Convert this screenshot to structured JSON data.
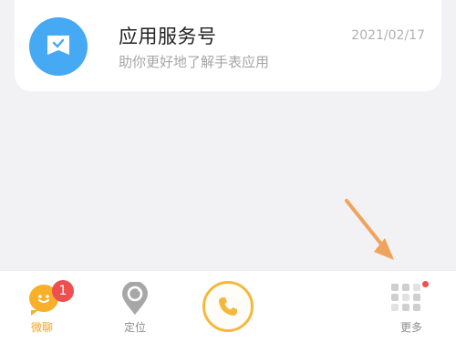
{
  "card": {
    "title": "应用服务号",
    "subtitle": "助你更好地了解手表应用",
    "date": "2021/02/17",
    "icon": "chat-check-icon",
    "icon_color": "#46a9f4"
  },
  "tabbar": {
    "chat": {
      "label": "微聊",
      "badge": "1",
      "color": "#f3a51a"
    },
    "location": {
      "label": "定位"
    },
    "call": {
      "icon": "phone-icon"
    },
    "more": {
      "label": "更多",
      "has_dot": true
    }
  },
  "annotation": {
    "arrow_color": "#f0a35c"
  }
}
